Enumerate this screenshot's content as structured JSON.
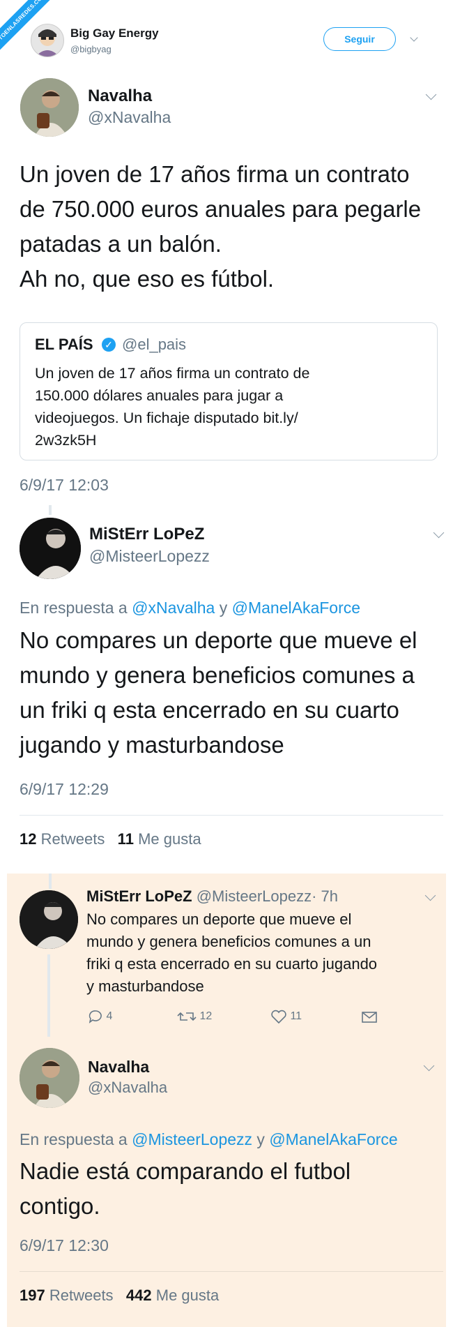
{
  "watermark": "VISTOENLASREDES.COM",
  "header": {
    "name": "Big Gay Energy",
    "handle": "@bigbyag",
    "follow_label": "Seguir"
  },
  "tweet1": {
    "name": "Navalha",
    "handle": "@xNavalha",
    "lines": [
      "Un joven de 17 años firma un contrato",
      "de 750.000 euros anuales para pegarle",
      "patadas a un balón.",
      "Ah no, que eso es fútbol."
    ],
    "quote": {
      "name": "EL PAÍS",
      "handle": "@el_pais",
      "lines": [
        "Un joven de 17 años firma un contrato de",
        "150.000 dólares anuales para jugar a",
        "videojuegos. Un fichaje disputado bit.ly/",
        "2w3zk5H"
      ]
    },
    "timestamp": "6/9/17 12:03"
  },
  "tweet2": {
    "name": "MiStErr LoPeZ",
    "handle": "@MisteerLopezz",
    "reply_prefix": "En respuesta a",
    "reply_user1": "@xNavalha",
    "reply_joiner": "y",
    "reply_user2": "@ManelAkaForce",
    "lines": [
      "No compares un deporte que mueve el",
      "mundo y genera beneficios comunes a",
      "un friki q esta encerrado en su cuarto",
      "jugando y masturbandose"
    ],
    "timestamp": "6/9/17 12:29",
    "retweets_count": "12",
    "retweets_label": "Retweets",
    "likes_count": "11",
    "likes_label": "Me gusta"
  },
  "tweet3": {
    "name": "MiStErr LoPeZ",
    "handle": "@MisteerLopezz",
    "time": "· 7h",
    "lines": [
      "No compares un deporte que mueve el",
      "mundo y genera beneficios comunes a un",
      "friki q esta encerrado en su cuarto jugando",
      "y masturbandose"
    ],
    "replies": "4",
    "retweets": "12",
    "likes": "11"
  },
  "tweet4": {
    "name": "Navalha",
    "handle": "@xNavalha",
    "reply_prefix": "En respuesta a",
    "reply_user1": "@MisteerLopezz",
    "reply_joiner": "y",
    "reply_user2": "@ManelAkaForce",
    "lines": [
      "Nadie está comparando el futbol",
      "contigo."
    ],
    "timestamp": "6/9/17 12:30",
    "retweets_count": "197",
    "retweets_label": "Retweets",
    "likes_count": "442",
    "likes_label": "Me gusta"
  },
  "colors": {
    "accent": "#1da1f2",
    "link": "#1b95e0",
    "muted": "#657786",
    "reply_background": "#fdf0e2"
  }
}
